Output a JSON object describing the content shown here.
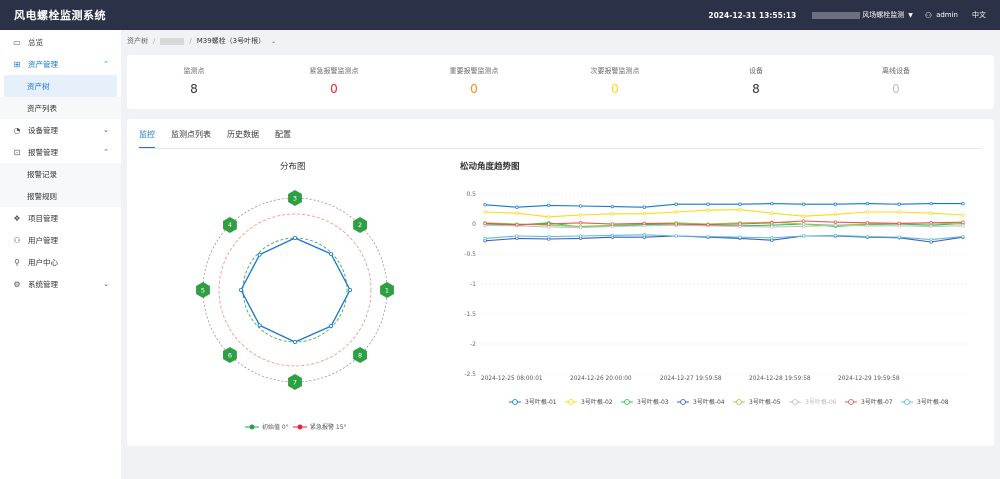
{
  "header": {
    "title": "风电螺栓监测系统",
    "datetime": "2024-12-31 13:55:13",
    "system": "风场螺栓监测",
    "user": "admin",
    "lang": "中文"
  },
  "sidebar": {
    "items": [
      {
        "label": "总览",
        "icon": "monitor-icon"
      },
      {
        "label": "资产管理",
        "icon": "assets-icon",
        "expanded": true,
        "children": [
          "资产树",
          "资产列表"
        ]
      },
      {
        "label": "设备管理",
        "icon": "device-icon"
      },
      {
        "label": "报警管理",
        "icon": "alarm-icon",
        "expanded": true,
        "children": [
          "报警记录",
          "报警规则"
        ]
      },
      {
        "label": "项目管理",
        "icon": "project-icon"
      },
      {
        "label": "用户管理",
        "icon": "users-icon"
      },
      {
        "label": "用户中心",
        "icon": "user-icon"
      },
      {
        "label": "系统管理",
        "icon": "gear-icon"
      }
    ]
  },
  "breadcrumb": {
    "root": "资产树",
    "current": "M39螺栓（3号叶根）"
  },
  "stats": [
    {
      "label": "监测点",
      "value": "8",
      "color": "#333333"
    },
    {
      "label": "紧急报警监测点",
      "value": "0",
      "color": "#f5222d"
    },
    {
      "label": "重要报警监测点",
      "value": "0",
      "color": "#fa8c16"
    },
    {
      "label": "次要报警监测点",
      "value": "0",
      "color": "#fadb14"
    },
    {
      "label": "设备",
      "value": "8",
      "color": "#333333"
    },
    {
      "label": "离线设备",
      "value": "0",
      "color": "#bfbfbf"
    }
  ],
  "tabs": [
    "监控",
    "监测点列表",
    "历史数据",
    "配置"
  ],
  "distribution": {
    "title": "分布图",
    "points": [
      "1",
      "2",
      "3",
      "4",
      "5",
      "6",
      "7",
      "8"
    ],
    "legend": [
      {
        "label": "初始值 0°",
        "color": "#2ea043"
      },
      {
        "label": "紧急报警 15°",
        "color": "#f5222d"
      }
    ]
  },
  "chart_data": {
    "type": "line",
    "title": "松动角度趋势图",
    "x": [
      "2024-12-25 08:00:01",
      "2024-12-26 20:00:00",
      "2024-12-27 19:59:58",
      "2024-12-28 19:59:58",
      "2024-12-29 19:59:58"
    ],
    "ylim": [
      -2.5,
      0.5
    ],
    "yticks": [
      "0.5",
      "0",
      "-0.5",
      "-1",
      "-1.5",
      "-2",
      "-2.5"
    ],
    "series": [
      {
        "name": "3号叶根-01",
        "color": "#1677d2",
        "values": [
          0.32,
          0.28,
          0.31,
          0.3,
          0.29,
          0.28,
          0.33,
          0.33,
          0.33,
          0.34,
          0.33,
          0.33,
          0.34,
          0.33,
          0.34,
          0.34
        ]
      },
      {
        "name": "3号叶根-02",
        "color": "#fadb14",
        "values": [
          0.2,
          0.18,
          0.12,
          0.15,
          0.17,
          0.17,
          0.2,
          0.23,
          0.24,
          0.18,
          0.13,
          0.16,
          0.2,
          0.2,
          0.18,
          0.15
        ]
      },
      {
        "name": "3号叶根-03",
        "color": "#2fc25b",
        "values": [
          0.0,
          -0.02,
          0.02,
          -0.05,
          -0.03,
          -0.01,
          0.0,
          -0.02,
          -0.03,
          -0.02,
          0.0,
          -0.04,
          -0.01,
          0.0,
          -0.02,
          0.01
        ]
      },
      {
        "name": "3号叶根-04",
        "color": "#3b5ec2",
        "values": [
          -0.28,
          -0.24,
          -0.25,
          -0.24,
          -0.22,
          -0.22,
          -0.2,
          -0.22,
          -0.24,
          -0.27,
          -0.2,
          -0.2,
          -0.22,
          -0.23,
          -0.3,
          -0.22
        ]
      },
      {
        "name": "3号叶根-05",
        "color": "#8fd14f",
        "values": [
          0.02,
          0.0,
          -0.02,
          -0.04,
          -0.02,
          0.01,
          0.02,
          0.0,
          0.02,
          0.03,
          0.0,
          -0.02,
          0.0,
          0.01,
          0.02,
          0.0
        ]
      },
      {
        "name": "3号叶根-06",
        "color": "#c0c0c0",
        "values": [
          -0.02,
          -0.03,
          -0.05,
          -0.06,
          -0.04,
          -0.03,
          -0.02,
          -0.03,
          -0.04,
          -0.05,
          -0.04,
          -0.02,
          -0.03,
          -0.03,
          -0.04,
          -0.03
        ]
      },
      {
        "name": "3号叶根-07",
        "color": "#e05a4f",
        "values": [
          0.01,
          -0.01,
          0.0,
          0.02,
          0.0,
          0.01,
          0.0,
          -0.01,
          0.0,
          0.02,
          0.05,
          0.03,
          0.02,
          0.01,
          0.02,
          0.03
        ]
      },
      {
        "name": "3号叶根-08",
        "color": "#5fbcd3",
        "values": [
          -0.24,
          -0.2,
          -0.21,
          -0.2,
          -0.19,
          -0.18,
          -0.2,
          -0.21,
          -0.22,
          -0.23,
          -0.2,
          -0.19,
          -0.21,
          -0.22,
          -0.26,
          -0.21
        ]
      }
    ]
  }
}
